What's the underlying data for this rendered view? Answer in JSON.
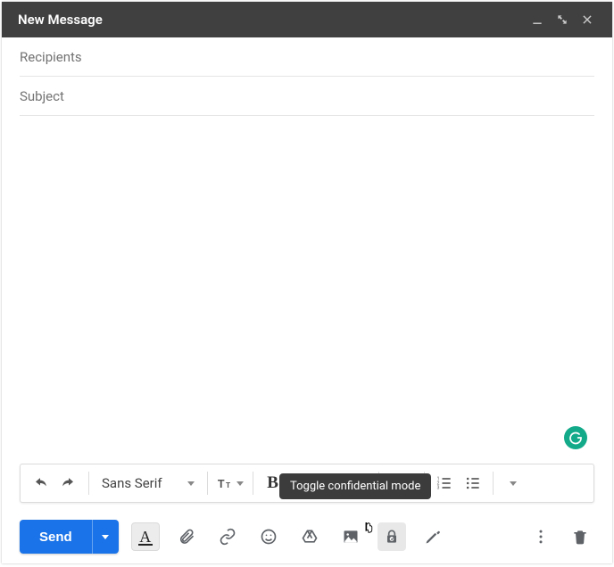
{
  "titlebar": {
    "title": "New Message"
  },
  "fields": {
    "recipients_placeholder": "Recipients",
    "subject_placeholder": "Subject"
  },
  "format": {
    "font_family": "Sans Serif"
  },
  "send": {
    "label": "Send"
  },
  "tooltip": {
    "confidential": "Toggle confidential mode"
  }
}
